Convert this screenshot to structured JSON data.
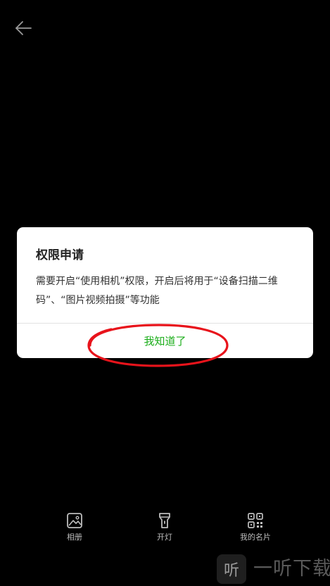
{
  "colors": {
    "background": "#000000",
    "dialog_background": "#ffffff",
    "accent_green": "#1aad19",
    "annotation_red": "#e8131b",
    "toolbar_text": "#bdbdbd"
  },
  "top_bar": {
    "back_icon": "arrow-left-icon"
  },
  "dialog": {
    "title": "权限申请",
    "message": "需要开启“使用相机”权限，开启后将用于“设备扫描二维码”、“图片视频拍摄”等功能",
    "confirm_label": "我知道了"
  },
  "toolbar": {
    "items": [
      {
        "label": "相册",
        "icon": "image-icon"
      },
      {
        "label": "开灯",
        "icon": "flashlight-icon"
      },
      {
        "label": "我的名片",
        "icon": "qr-code-icon"
      }
    ]
  },
  "watermark": {
    "logo_text": "听",
    "text": "一听下载"
  }
}
